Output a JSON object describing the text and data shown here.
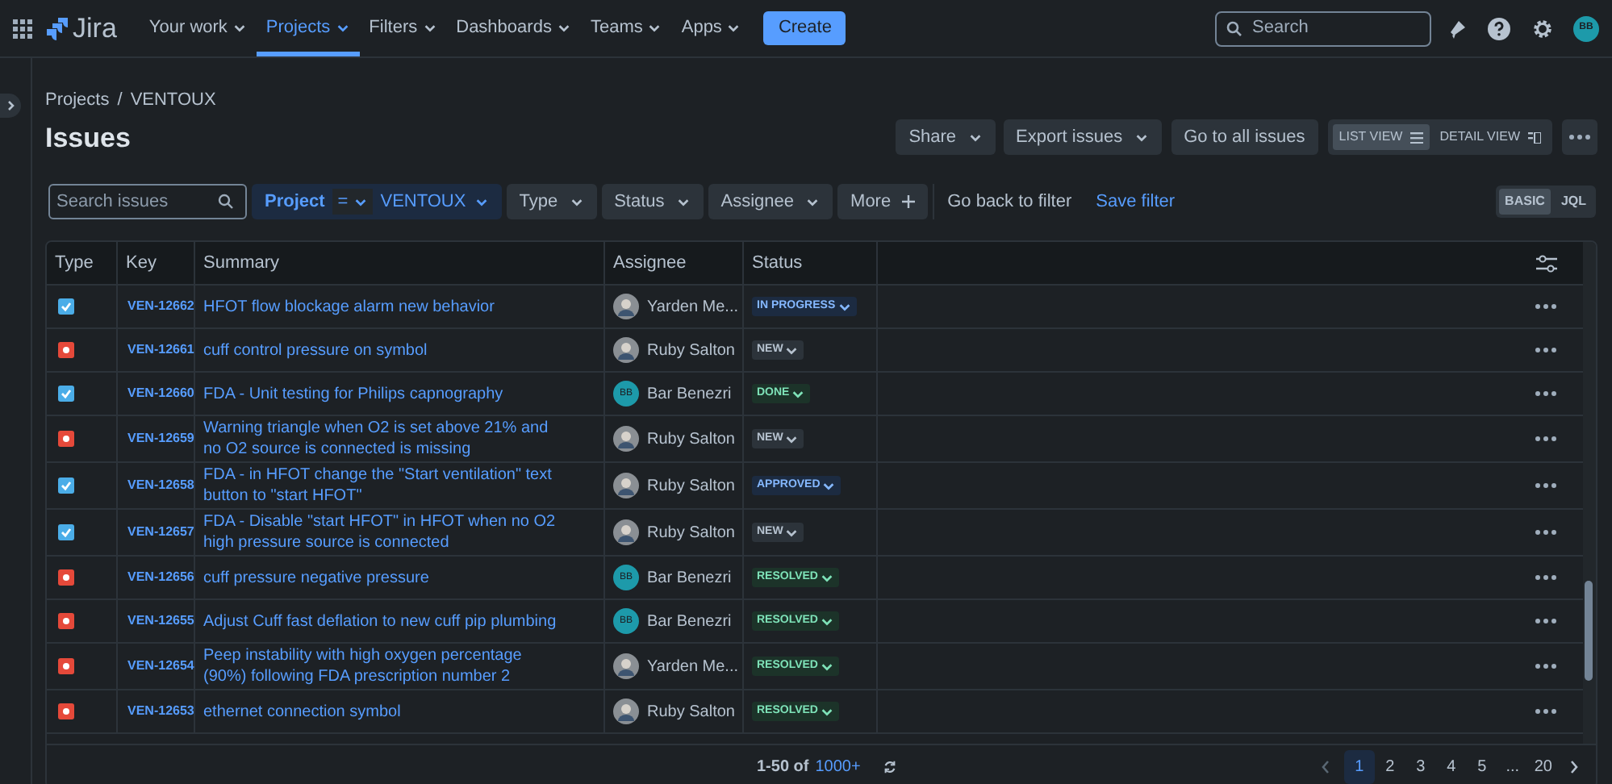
{
  "nav": {
    "product": "Jira",
    "menus": [
      {
        "label": "Your work",
        "selected": false
      },
      {
        "label": "Projects",
        "selected": true
      },
      {
        "label": "Filters",
        "selected": false
      },
      {
        "label": "Dashboards",
        "selected": false
      },
      {
        "label": "Teams",
        "selected": false
      },
      {
        "label": "Apps",
        "selected": false
      }
    ],
    "create": "Create",
    "search_placeholder": "Search",
    "user_initials": "BB"
  },
  "breadcrumbs": [
    "Projects",
    "/",
    "VENTOUX"
  ],
  "title": "Issues",
  "actions": {
    "share": "Share",
    "export": "Export issues",
    "all": "Go to all issues",
    "views": [
      {
        "label": "LIST VIEW",
        "selected": true
      },
      {
        "label": "DETAIL VIEW",
        "selected": false
      }
    ]
  },
  "filters": {
    "search_placeholder": "Search issues",
    "project": {
      "label": "Project",
      "operator": "=",
      "value": "VENTOUX"
    },
    "dropdowns": [
      "Type",
      "Status",
      "Assignee"
    ],
    "more": "More",
    "back": "Go back to filter",
    "save": "Save filter",
    "modes": [
      {
        "label": "BASIC",
        "selected": true
      },
      {
        "label": "JQL",
        "selected": false
      }
    ]
  },
  "table": {
    "columns": [
      "Type",
      "Key",
      "Summary",
      "Assignee",
      "Status"
    ],
    "rows": [
      {
        "kind": "task",
        "key": "VEN-12662",
        "summary": "HFOT flow blockage alarm new behavior",
        "assignee": "Yarden Me...",
        "avatar": {
          "kind": "photo"
        },
        "status": "IN PROGRESS",
        "color": "#1c2b41"
      },
      {
        "kind": "bug",
        "key": "VEN-12661",
        "summary": "cuff control pressure on symbol",
        "assignee": "Ruby Salton",
        "avatar": {
          "kind": "photo"
        },
        "status": "NEW",
        "color": "#2c333a"
      },
      {
        "kind": "task",
        "key": "VEN-12660",
        "summary": "FDA - Unit testing for Philips capnography",
        "assignee": "Bar Benezri",
        "avatar": {
          "kind": "initials",
          "text": "BB"
        },
        "status": "DONE",
        "color": "#1c3329"
      },
      {
        "kind": "bug",
        "key": "VEN-12659",
        "summary": "Warning triangle when O2 is set above 21% and no O2 source is connected is missing",
        "assignee": "Ruby Salton",
        "avatar": {
          "kind": "photo"
        },
        "status": "NEW",
        "color": "#2c333a"
      },
      {
        "kind": "task",
        "key": "VEN-12658",
        "summary": "FDA - in HFOT change the \"Start ventilation\" text button to \"start HFOT\"",
        "assignee": "Ruby Salton",
        "avatar": {
          "kind": "photo"
        },
        "status": "APPROVED",
        "color": "#1c2b41"
      },
      {
        "kind": "task",
        "key": "VEN-12657",
        "summary": "FDA - Disable \"start HFOT\" in HFOT when no O2 high pressure source is connected",
        "assignee": "Ruby Salton",
        "avatar": {
          "kind": "photo"
        },
        "status": "NEW",
        "color": "#2c333a"
      },
      {
        "kind": "bug",
        "key": "VEN-12656",
        "summary": "cuff pressure negative pressure",
        "assignee": "Bar Benezri",
        "avatar": {
          "kind": "initials",
          "text": "BB"
        },
        "status": "RESOLVED",
        "color": "#1c3329"
      },
      {
        "kind": "bug",
        "key": "VEN-12655",
        "summary": "Adjust Cuff fast deflation to new cuff pip plumbing",
        "assignee": "Bar Benezri",
        "avatar": {
          "kind": "initials",
          "text": "BB"
        },
        "status": "RESOLVED",
        "color": "#1c3329"
      },
      {
        "kind": "bug",
        "key": "VEN-12654",
        "summary": "Peep instability with high oxygen percentage (90%) following FDA prescription number 2",
        "assignee": "Yarden Me...",
        "avatar": {
          "kind": "photo"
        },
        "status": "RESOLVED",
        "color": "#1c3329"
      },
      {
        "kind": "bug",
        "key": "VEN-12653",
        "summary": "ethernet connection symbol",
        "assignee": "Ruby Salton",
        "avatar": {
          "kind": "photo"
        },
        "status": "RESOLVED",
        "color": "#1c3329"
      }
    ]
  },
  "footer": {
    "range": "1-50 of",
    "total": "1000+",
    "pages": [
      {
        "label": "1",
        "selected": true
      },
      {
        "label": "2",
        "selected": false
      },
      {
        "label": "3",
        "selected": false
      },
      {
        "label": "4",
        "selected": false
      },
      {
        "label": "5",
        "selected": false
      },
      {
        "label": "...",
        "selected": false
      },
      {
        "label": "20",
        "selected": false
      }
    ]
  }
}
